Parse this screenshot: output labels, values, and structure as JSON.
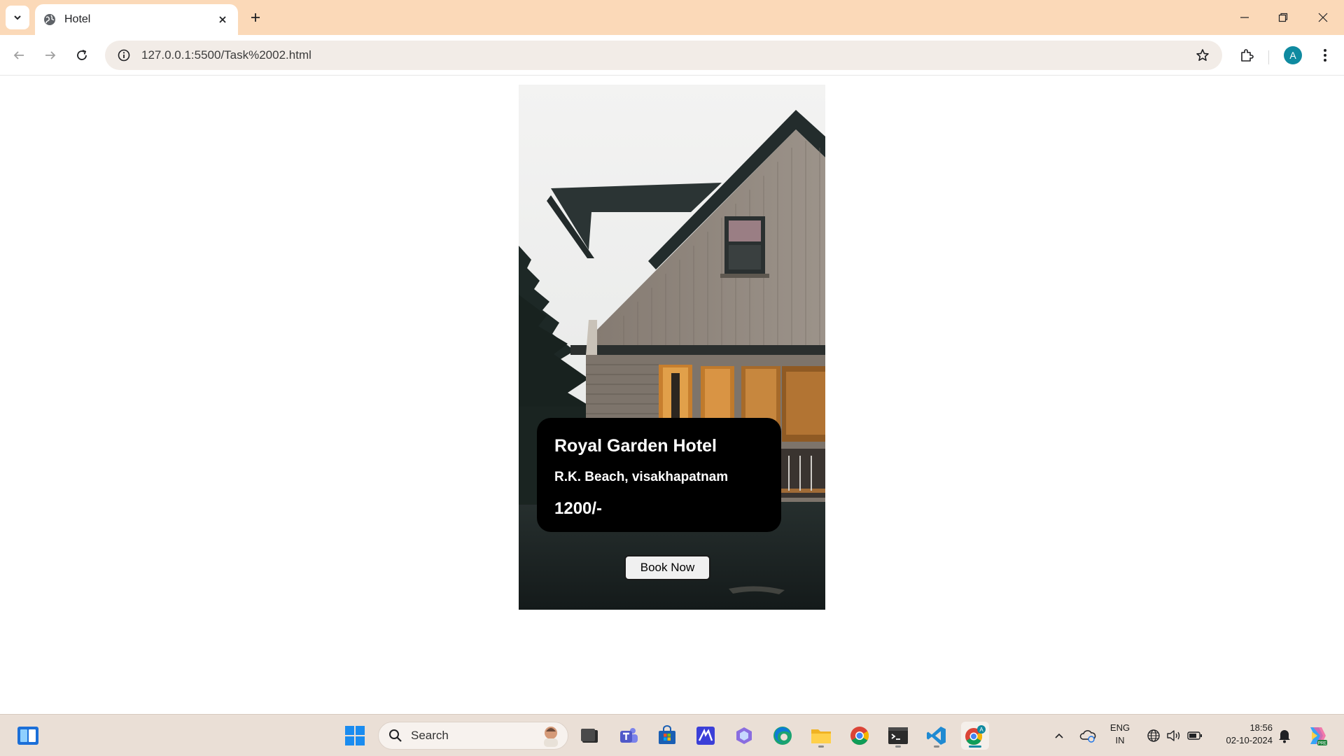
{
  "browser": {
    "tab": {
      "title": "Hotel"
    },
    "address_bar": {
      "url": "127.0.0.1:5500/Task%2002.html"
    },
    "profile": {
      "initial": "A"
    }
  },
  "page": {
    "hotel": {
      "name": "Royal Garden Hotel",
      "location": "R.K. Beach, visakhapatnam",
      "price": "1200/-"
    },
    "book_button": {
      "label": "Book Now"
    }
  },
  "taskbar": {
    "search": {
      "placeholder": "Search"
    },
    "language": {
      "line1": "ENG",
      "line2": "IN"
    },
    "clock": {
      "time": "18:56",
      "date": "02-10-2024"
    },
    "pinned_apps": [
      "file-explorer-icon",
      "teams-icon",
      "store-icon",
      "app-icon",
      "copilot-icon",
      "edge-icon",
      "folder-icon",
      "chrome-icon",
      "terminal-icon",
      "vscode-icon",
      "chrome-profile-icon"
    ]
  },
  "colors": {
    "tabstrip": "#fbd9b8",
    "omnibox": "#f2ece7",
    "info_box": "#000000",
    "avatar": "#0f8aa0",
    "taskbar": "#eadfd6"
  }
}
